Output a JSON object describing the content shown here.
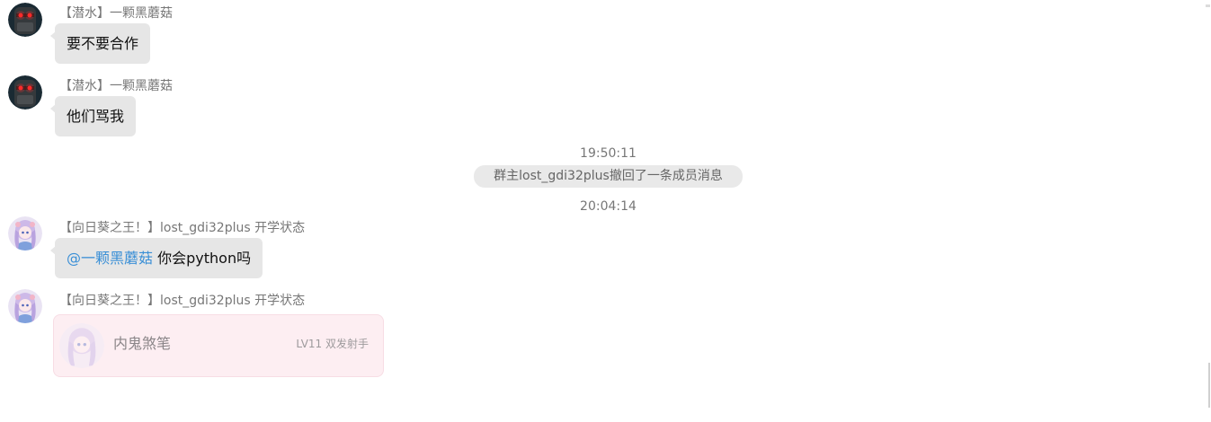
{
  "messages": [
    {
      "sender": "【潜水】一颗黑蘑菇",
      "text": "要不要合作"
    },
    {
      "sender": "【潜水】一颗黑蘑菇",
      "text": "他们骂我"
    },
    {
      "sender": "【向日葵之王！】lost_gdi32plus 开学状态",
      "mention": "@一颗黑蘑菇",
      "text": "你会python吗"
    },
    {
      "sender": "【向日葵之王！】lost_gdi32plus 开学状态",
      "card": {
        "name": "内鬼煞笔",
        "level": "LV11 双发射手"
      }
    }
  ],
  "timestamps": [
    "19:50:11",
    "20:04:14"
  ],
  "system_notice": "群主lost_gdi32plus撤回了一条成员消息",
  "colors": {
    "bubble": "#e6e6e6",
    "mention": "#3a8fd6",
    "card_background": "#fdeef2",
    "muted_text": "#777777"
  },
  "icons": {
    "mushroom_avatar": "dark-robot-avatar-icon",
    "anime_avatar": "anime-girl-avatar-icon"
  }
}
